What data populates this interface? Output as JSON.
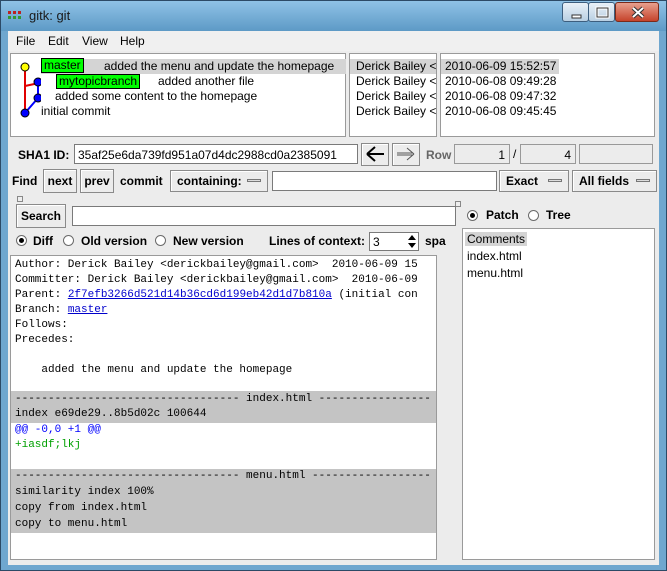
{
  "window": {
    "title": "gitk: git"
  },
  "menu": {
    "file": "File",
    "edit": "Edit",
    "view": "View",
    "help": "Help"
  },
  "commits": [
    {
      "branch": "master",
      "message": "added the menu and update the homepage",
      "author": "Derick Bailey <",
      "date": "2010-06-09 15:52:57"
    },
    {
      "branch": "mytopicbranch",
      "message": "added another file",
      "author": "Derick Bailey <",
      "date": "2010-06-08 09:49:28"
    },
    {
      "branch": "",
      "message": "added some content to the homepage",
      "author": "Derick Bailey <",
      "date": "2010-06-08 09:47:32"
    },
    {
      "branch": "",
      "message": "initial commit",
      "author": "Derick Bailey <",
      "date": "2010-06-08 09:45:45"
    }
  ],
  "sha": {
    "label": "SHA1 ID:",
    "value": "35af25e6da739fd951a07d4dc2988cd0a2385091",
    "row_label": "Row",
    "row_current": "1",
    "row_sep": "/",
    "row_total": "4"
  },
  "find": {
    "label": "Find",
    "next": "next",
    "prev": "prev",
    "commit": "commit",
    "containing": "containing:",
    "exact": "Exact",
    "all_fields": "All fields"
  },
  "search": {
    "button": "Search"
  },
  "diff_options": {
    "diff": "Diff",
    "old_version": "Old version",
    "new_version": "New version",
    "lines_of_context_label": "Lines of context:",
    "lines_of_context_value": "3",
    "overflow": "spa"
  },
  "details": {
    "author": "Author: Derick Bailey <derickbailey@gmail.com>  2010-06-09 15",
    "committer": "Committer: Derick Bailey <derickbailey@gmail.com>  2010-06-09",
    "parent_prefix": "Parent: ",
    "parent_hash": "2f7efb3266d521d14b36cd6d199eb42d1d7b810a",
    "parent_suffix": " (initial con",
    "branch_prefix": "Branch: ",
    "branch_name": "master",
    "follows": "Follows:",
    "precedes": "Precedes:",
    "message": "    added the menu and update the homepage",
    "sep1": "---------------------------------- index.html -----------------",
    "index_line": "index e69de29..8b5d02c 100644",
    "hunk": "@@ -0,0 +1 @@",
    "added": "+iasdf;lkj",
    "sep2": "---------------------------------- menu.html ------------------",
    "similarity": "similarity index 100%",
    "copy_from": "copy from index.html",
    "copy_to": "copy to menu.html"
  },
  "file_panel": {
    "patch": "Patch",
    "tree": "Tree",
    "items": [
      "Comments",
      "index.html",
      "menu.html"
    ]
  },
  "colors": {
    "branch_green": "#00ff00",
    "graph_red": "#e00000",
    "graph_blue": "#0000ff",
    "graph_yellow": "#ffff00",
    "hunk_blue": "#0000ff",
    "added_green": "#00a000"
  }
}
